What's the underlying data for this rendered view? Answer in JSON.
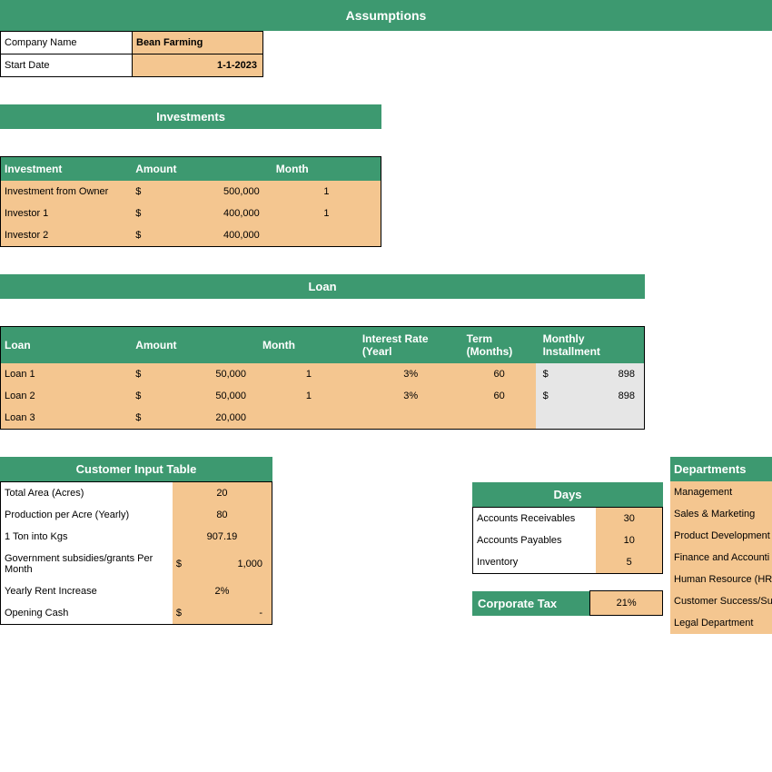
{
  "titles": {
    "assumptions": "Assumptions",
    "investments": "Investments",
    "loan": "Loan",
    "customer_input": "Customer Input Table",
    "days": "Days",
    "corporate_tax": "Corporate Tax",
    "departments": "Departments"
  },
  "company": {
    "label_name": "Company Name",
    "name": "Bean Farming",
    "label_start": "Start Date",
    "start": "1-1-2023"
  },
  "investments": {
    "h1": "Investment",
    "h2": "Amount",
    "h3": "Month",
    "rows": [
      {
        "name": "Investment from Owner",
        "cur": "$",
        "amount": "500,000",
        "month": "1"
      },
      {
        "name": "Investor 1",
        "cur": "$",
        "amount": "400,000",
        "month": "1"
      },
      {
        "name": "Investor 2",
        "cur": "$",
        "amount": "400,000",
        "month": ""
      }
    ]
  },
  "loan": {
    "h1": "Loan",
    "h2": "Amount",
    "h3": "Month",
    "h4": "Interest Rate (Yearl",
    "h5": "Term (Months)",
    "h6": "Monthly Installment",
    "rows": [
      {
        "name": "Loan 1",
        "cur": "$",
        "amount": "50,000",
        "month": "1",
        "rate": "3%",
        "term": "60",
        "cur2": "$",
        "inst": "898"
      },
      {
        "name": "Loan 2",
        "cur": "$",
        "amount": "50,000",
        "month": "1",
        "rate": "3%",
        "term": "60",
        "cur2": "$",
        "inst": "898"
      },
      {
        "name": "Loan 3",
        "cur": "$",
        "amount": "20,000",
        "month": "",
        "rate": "",
        "term": "",
        "cur2": "",
        "inst": ""
      }
    ]
  },
  "customer_input": {
    "rows": [
      {
        "label": "Total Area (Acres)",
        "cur": "",
        "val": "20",
        "align": "ctr"
      },
      {
        "label": "Production per Acre (Yearly)",
        "cur": "",
        "val": "80",
        "align": "ctr"
      },
      {
        "label": "1 Ton into Kgs",
        "cur": "",
        "val": "907.19",
        "align": "ctr"
      },
      {
        "label": "Government subsidies/grants Per Month",
        "cur": "$",
        "val": "1,000",
        "align": "amt"
      },
      {
        "label": "Yearly Rent Increase",
        "cur": "",
        "val": "2%",
        "align": "ctr"
      },
      {
        "label": "Opening Cash",
        "cur": "$",
        "val": "-",
        "align": "amt"
      }
    ]
  },
  "days": {
    "rows": [
      {
        "label": "Accounts Receivables",
        "val": "30"
      },
      {
        "label": "Accounts Payables",
        "val": "10"
      },
      {
        "label": "Inventory",
        "val": "5"
      }
    ]
  },
  "corporate_tax": {
    "val": "21%"
  },
  "departments": {
    "rows": [
      "Management",
      "Sales & Marketing",
      "Product Development",
      "Finance and Accounti",
      "Human Resource (HR)",
      "Customer Success/Sup",
      "Legal Department"
    ]
  }
}
